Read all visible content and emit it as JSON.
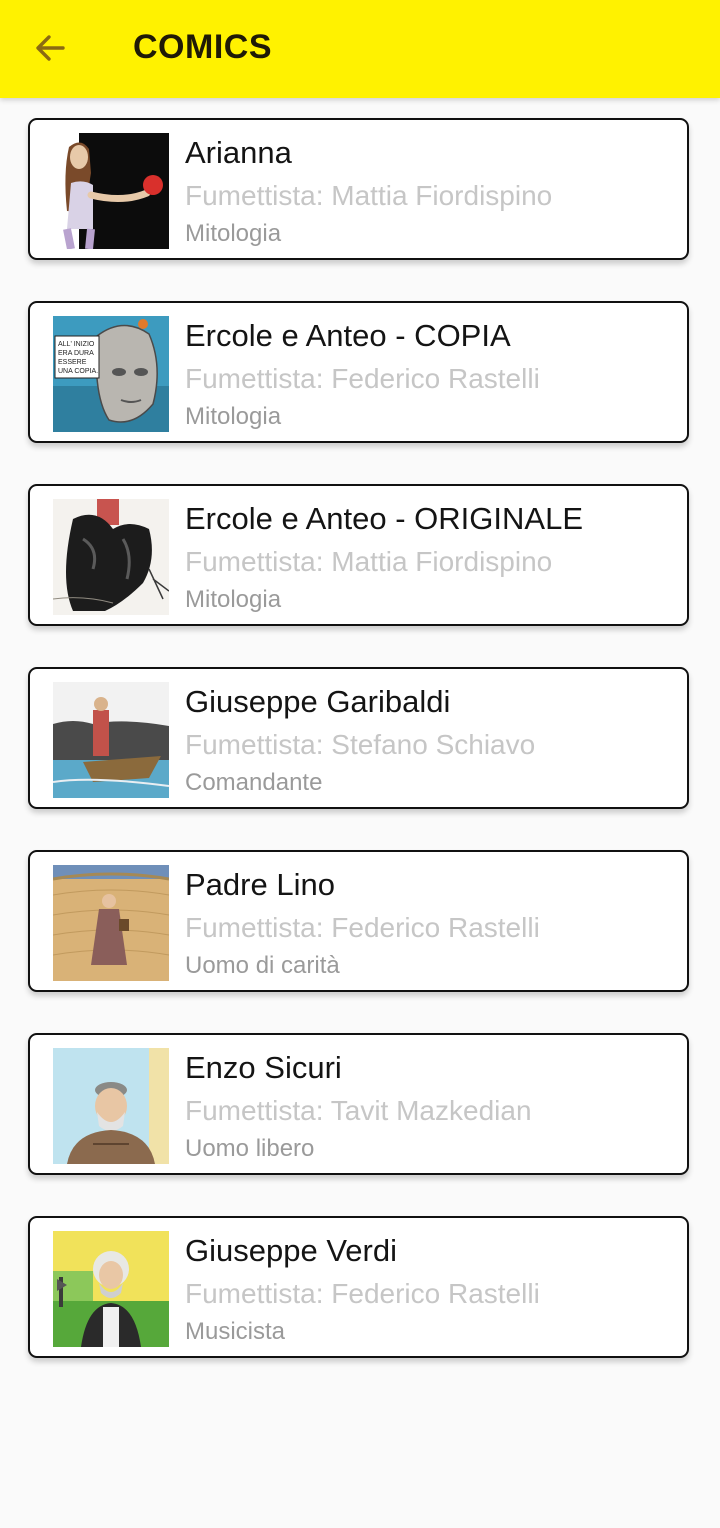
{
  "appbar": {
    "title": "COMICS",
    "back_icon": "arrow-left-icon",
    "background": "#fff200",
    "back_color": "#8a6a12"
  },
  "comics": [
    {
      "title": "Arianna",
      "author": "Fumettista: Mattia Fiordispino",
      "category": "Mitologia"
    },
    {
      "title": "Ercole e Anteo - COPIA",
      "author": "Fumettista: Federico Rastelli",
      "category": "Mitologia"
    },
    {
      "title": "Ercole e Anteo - ORIGINALE",
      "author": "Fumettista: Mattia Fiordispino",
      "category": "Mitologia"
    },
    {
      "title": "Giuseppe Garibaldi",
      "author": "Fumettista: Stefano Schiavo",
      "category": "Comandante"
    },
    {
      "title": "Padre Lino",
      "author": "Fumettista: Federico Rastelli",
      "category": "Uomo di carità"
    },
    {
      "title": "Enzo Sicuri",
      "author": "Fumettista: Tavit Mazkedian",
      "category": "Uomo libero"
    },
    {
      "title": "Giuseppe Verdi",
      "author": "Fumettista: Federico Rastelli",
      "category": "Musicista"
    }
  ],
  "thumb_text": {
    "ercole_copia": [
      "ALL' INIZIO",
      "ERA DURA",
      "ESSERE",
      "UNA COPIA."
    ]
  }
}
